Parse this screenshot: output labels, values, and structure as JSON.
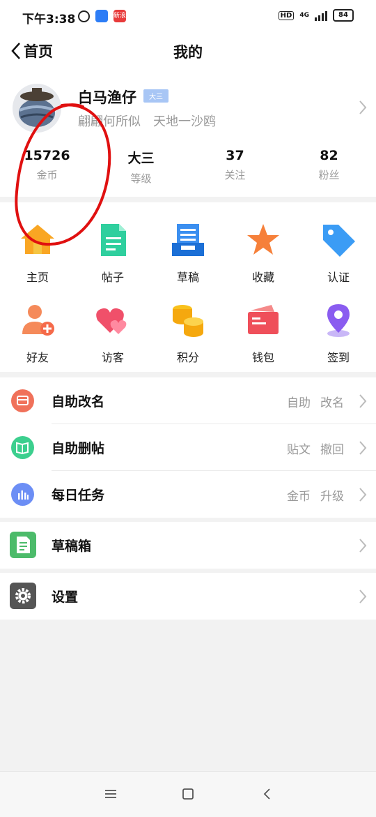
{
  "status_bar": {
    "time": "下午3:38",
    "app2_label": "新浪",
    "hd": "HD",
    "network": "4G",
    "battery": "84"
  },
  "header": {
    "back_label": "首页",
    "title": "我的"
  },
  "profile": {
    "name": "白马渔仔",
    "level_badge": "大三",
    "signature": "翩翩何所似　天地一沙鸥",
    "stats": [
      {
        "value": "15726",
        "label": "金币"
      },
      {
        "value": "大三",
        "label": "等级"
      },
      {
        "value": "37",
        "label": "关注"
      },
      {
        "value": "82",
        "label": "粉丝"
      }
    ]
  },
  "grid": [
    {
      "label": "主页",
      "icon": "home-icon"
    },
    {
      "label": "帖子",
      "icon": "post-icon"
    },
    {
      "label": "草稿",
      "icon": "draft-icon"
    },
    {
      "label": "收藏",
      "icon": "star-icon"
    },
    {
      "label": "认证",
      "icon": "tag-icon"
    },
    {
      "label": "好友",
      "icon": "add-friend-icon"
    },
    {
      "label": "访客",
      "icon": "hearts-icon"
    },
    {
      "label": "积分",
      "icon": "coins-icon"
    },
    {
      "label": "钱包",
      "icon": "wallet-icon"
    },
    {
      "label": "签到",
      "icon": "location-pin-icon"
    }
  ],
  "list1": [
    {
      "title": "自助改名",
      "right": [
        "自助",
        "改名"
      ],
      "icon": "rename-icon",
      "color": "#f0715a"
    },
    {
      "title": "自助删帖",
      "right": [
        "贴文",
        "撤回"
      ],
      "icon": "book-icon",
      "color": "#3ccf8e"
    },
    {
      "title": "每日任务",
      "right": [
        "金币",
        "升级"
      ],
      "icon": "task-chart-icon",
      "color": "#6c8ef5"
    }
  ],
  "list2": [
    {
      "title": "草稿箱",
      "icon": "draft-box-icon"
    }
  ],
  "list3": [
    {
      "title": "设置",
      "icon": "settings-gear-icon"
    }
  ]
}
